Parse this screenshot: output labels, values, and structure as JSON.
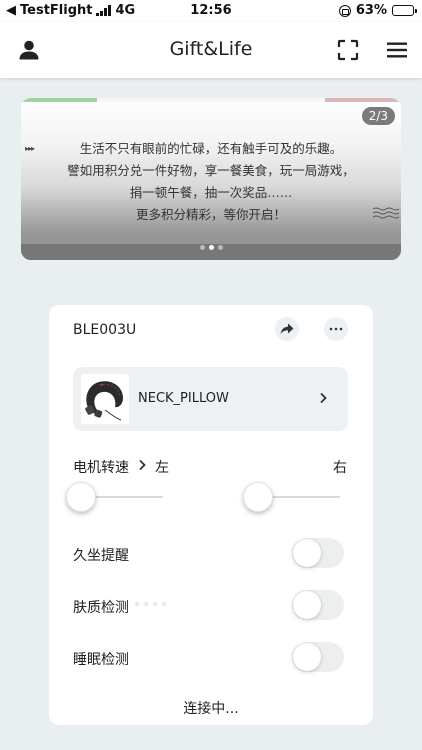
{
  "status_bar": {
    "back_app": "TestFlight",
    "network": "4G",
    "time": "12:56",
    "battery": "63%",
    "battery_level": 0.63
  },
  "header": {
    "title": "Gift&Life"
  },
  "banner": {
    "page_indicator": "2/3",
    "lines": [
      "生活不只有眼前的忙碌，还有触手可及的乐趣。",
      "譬如用积分兑一件好物，享一餐美食，玩一局游戏，",
      "捐一顿午餐，抽一次奖品……",
      "更多积分精彩，等你开启！"
    ],
    "dots_total": 3,
    "dots_active": 1
  },
  "device": {
    "id": "BLE003U",
    "product_name": "NECK_PILLOW",
    "motor_speed_label": "电机转速",
    "left_label": "左",
    "right_label": "右",
    "left_slider_value": 0,
    "right_slider_value": 0,
    "toggles": [
      {
        "label": "久坐提醒",
        "on": false
      },
      {
        "label": "肤质检测",
        "on": false,
        "rating_stars": "★★★★"
      },
      {
        "label": "睡眠检测",
        "on": false
      }
    ],
    "connection_status": "连接中..."
  },
  "colors": {
    "background": "#e9eef1",
    "card": "#ffffff",
    "tile": "#edf1f4"
  }
}
